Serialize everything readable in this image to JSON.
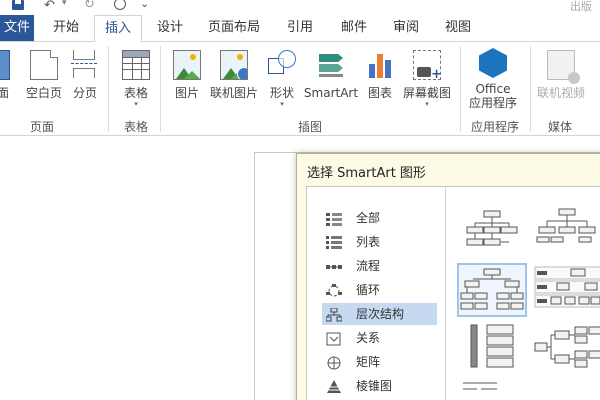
{
  "app": {
    "title": "出版"
  },
  "qat": {
    "undo_dropdown": "▾",
    "more": "⌄"
  },
  "tabs": {
    "file": "文件",
    "home": "开始",
    "insert": "插入",
    "design": "设计",
    "layout": "页面布局",
    "references": "引用",
    "mailings": "邮件",
    "review": "审阅",
    "view": "视图"
  },
  "ribbon": {
    "pages": {
      "cover": "面",
      "blank": "空白页",
      "break": "分页",
      "group": "页面"
    },
    "tables": {
      "table": "表格",
      "group": "表格"
    },
    "illustrations": {
      "pictures": "图片",
      "online_pictures": "联机图片",
      "shapes": "形状",
      "smartart": "SmartArt",
      "chart": "图表",
      "screenshot": "屏幕截图",
      "group": "插图"
    },
    "apps": {
      "office_line1": "Office",
      "office_line2": "应用程序",
      "group": "应用程序"
    },
    "media": {
      "online_video": "联机视频",
      "group": "媒体"
    },
    "dropdown_glyph": "▾"
  },
  "dialog": {
    "title": "选择 SmartArt 图形",
    "categories": [
      {
        "label": "全部",
        "icon": "all-icon"
      },
      {
        "label": "列表",
        "icon": "list-icon"
      },
      {
        "label": "流程",
        "icon": "process-icon"
      },
      {
        "label": "循环",
        "icon": "cycle-icon"
      },
      {
        "label": "层次结构",
        "icon": "hierarchy-icon"
      },
      {
        "label": "关系",
        "icon": "relationship-icon"
      },
      {
        "label": "矩阵",
        "icon": "matrix-icon"
      },
      {
        "label": "棱锥图",
        "icon": "pyramid-icon"
      }
    ],
    "selected_category": "层次结构"
  },
  "colors": {
    "accent": "#2b579a",
    "selected_category_bg": "#c5d9f1",
    "dialog_bg": "#fdfbe5",
    "thumb_selected_border": "#9ec4ea"
  }
}
